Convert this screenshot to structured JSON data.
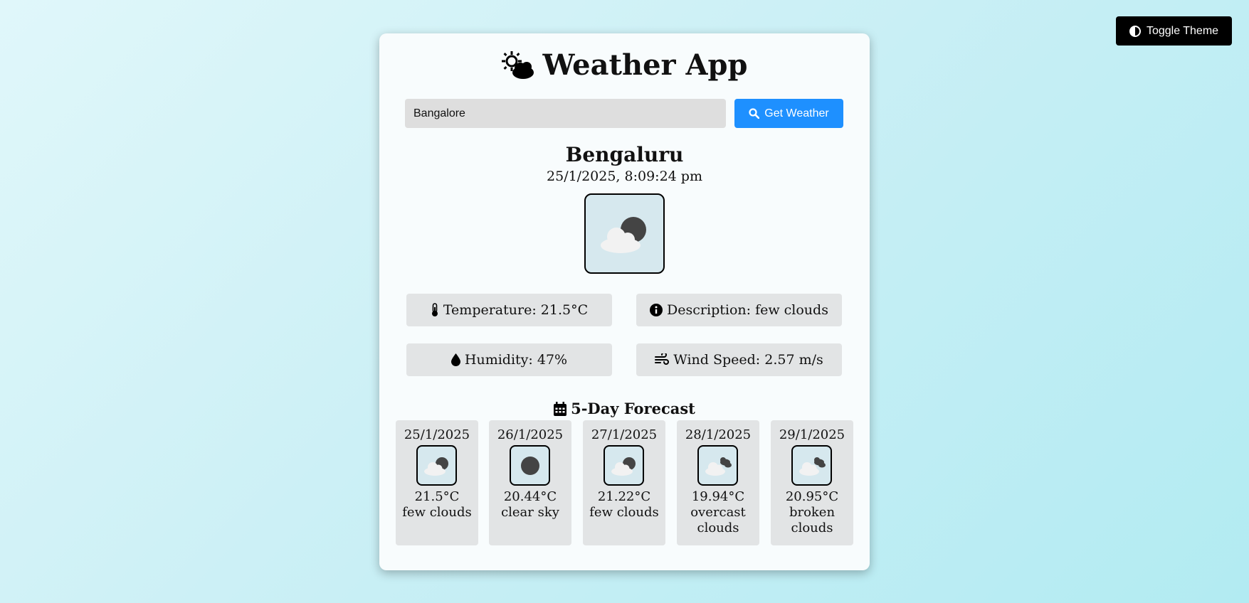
{
  "header": {
    "toggle_label": "Toggle Theme"
  },
  "app": {
    "title": "Weather App"
  },
  "search": {
    "value": "Bangalore",
    "button_label": "Get Weather"
  },
  "current": {
    "city": "Bengaluru",
    "datetime": "25/1/2025, 8:09:24 pm",
    "icon": "partly-cloudy-night-icon",
    "stats": {
      "temperature": "Temperature: 21.5°C",
      "description": "Description: few clouds",
      "humidity": "Humidity: 47%",
      "wind": "Wind Speed: 2.57 m/s"
    }
  },
  "forecast": {
    "heading": "5-Day Forecast",
    "days": [
      {
        "date": "25/1/2025",
        "temp": "21.5°C",
        "desc": "few clouds",
        "icon": "few-clouds-night-icon"
      },
      {
        "date": "26/1/2025",
        "temp": "20.44°C",
        "desc": "clear sky",
        "icon": "clear-night-icon"
      },
      {
        "date": "27/1/2025",
        "temp": "21.22°C",
        "desc": "few clouds",
        "icon": "few-clouds-night-icon"
      },
      {
        "date": "28/1/2025",
        "temp": "19.94°C",
        "desc": "overcast clouds",
        "icon": "overcast-clouds-icon"
      },
      {
        "date": "29/1/2025",
        "temp": "20.95°C",
        "desc": "broken clouds",
        "icon": "broken-clouds-icon"
      }
    ]
  },
  "colors": {
    "accent": "#1e90ff",
    "card_bg": "#f8fcfd",
    "stat_bg": "#e2e4e5",
    "icon_bg": "#d6e8ee"
  }
}
